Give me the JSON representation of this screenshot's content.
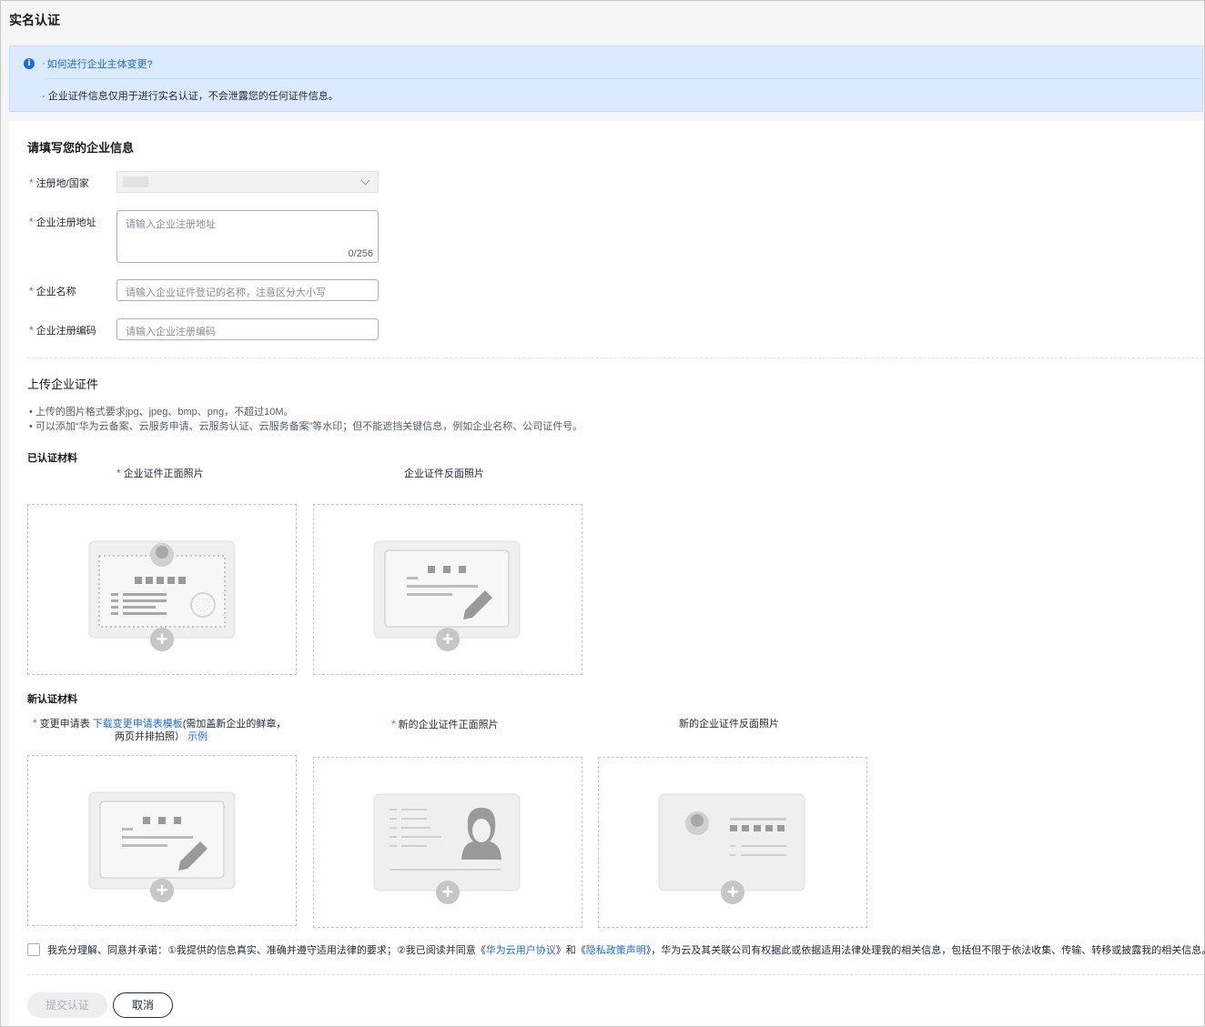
{
  "page": {
    "title": "实名认证"
  },
  "notice": {
    "link_prefix": "· ",
    "link_text": "如何进行企业主体变更?",
    "note": "· 企业证件信息仅用于进行实名认证，不会泄露您的任何证件信息。"
  },
  "form": {
    "section_title": "请填写您的企业信息",
    "required_mark": "*",
    "country": {
      "label": "注册地/国家",
      "value": ""
    },
    "address": {
      "label": "企业注册地址",
      "placeholder": "请输入企业注册地址",
      "count": "0/256"
    },
    "name": {
      "label": "企业名称",
      "placeholder": "请输入企业证件登记的名称，注意区分大小写"
    },
    "code": {
      "label": "企业注册编码",
      "placeholder": "请输入企业注册编码"
    }
  },
  "upload": {
    "title": "上传企业证件",
    "tips": [
      "上传的图片格式要求jpg、jpeg、bmp、png，不超过10M。",
      "可以添加“华为云备案、云服务申请、云服务认证、云服务备案”等水印；但不能遮挡关键信息，例如企业名称、公司证件号。"
    ],
    "certified": {
      "title": "已认证材料",
      "front": "企业证件正面照片",
      "back": "企业证件反面照片"
    },
    "new": {
      "title": "新认证材料",
      "form_label": "变更申请表",
      "download_link": "下载变更申请表模板",
      "form_note_1": "(需加盖新企业的鲜章，",
      "form_note_2": "两页并排拍照）",
      "example_link": "示例",
      "front": "新的企业证件正面照片",
      "back": "新的企业证件反面照片"
    },
    "plus_symbol": "+"
  },
  "agreement": {
    "text_1": "我充分理解、同意并承诺：①我提供的信息真实、准确并遵守适用法律的要求；②我已阅读并同意《",
    "link_1": "华为云用户协议",
    "text_2": "》和《",
    "link_2": "隐私政策声明",
    "text_3": "》，华为云及其关联公司有权据此或依据适用法律处理我的相关信息，包括但不限于依法收集、传输、转移或披露我的相关信息。"
  },
  "actions": {
    "submit": "提交认证",
    "cancel": "取消"
  }
}
